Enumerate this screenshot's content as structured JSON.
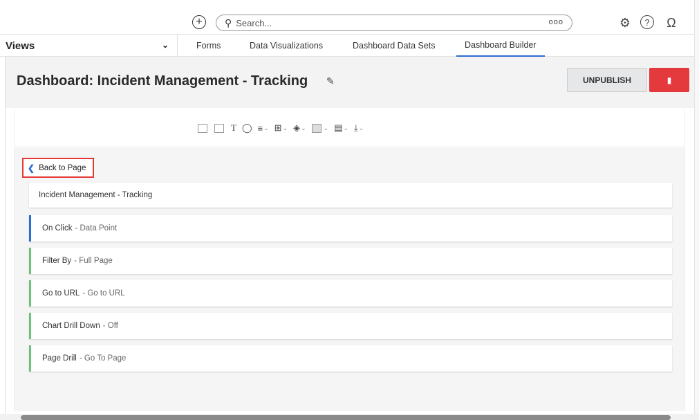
{
  "topbar": {
    "add_icon": "plus-circle-icon",
    "search_placeholder": "Search...",
    "search_icon_glyph": "🔍",
    "options_label": "ooo",
    "settings_icon": "gear-icon",
    "help_icon": "help-icon",
    "user_icon": "user-icon"
  },
  "nav": {
    "views_label": "Views",
    "tabs": [
      {
        "label": "Forms"
      },
      {
        "label": "Data Visualizations"
      },
      {
        "label": "Dashboard Data Sets"
      },
      {
        "label": "Dashboard Builder"
      }
    ],
    "active_tab": "Dashboard Builder"
  },
  "header": {
    "title": "Dashboard: Incident Management - Tracking",
    "unpublish_label": "UNPUBLISH"
  },
  "back_link": {
    "label": "Back to Page"
  },
  "cards": [
    {
      "label": "Incident Management - Tracking",
      "value": ""
    },
    {
      "label": "On Click",
      "value": "- Data Point"
    },
    {
      "label": "Filter By",
      "value": "- Full Page"
    },
    {
      "label": "Go to URL",
      "value": "- Go to URL"
    },
    {
      "label": "Chart Drill Down",
      "value": "- Off"
    },
    {
      "label": "Page Drill",
      "value": "- Go To Page"
    }
  ],
  "colors": {
    "accent_blue": "#2b6cd1",
    "danger_red": "#e43a3d",
    "highlight_red": "#e53935",
    "green_bar": "#6fc27e"
  }
}
